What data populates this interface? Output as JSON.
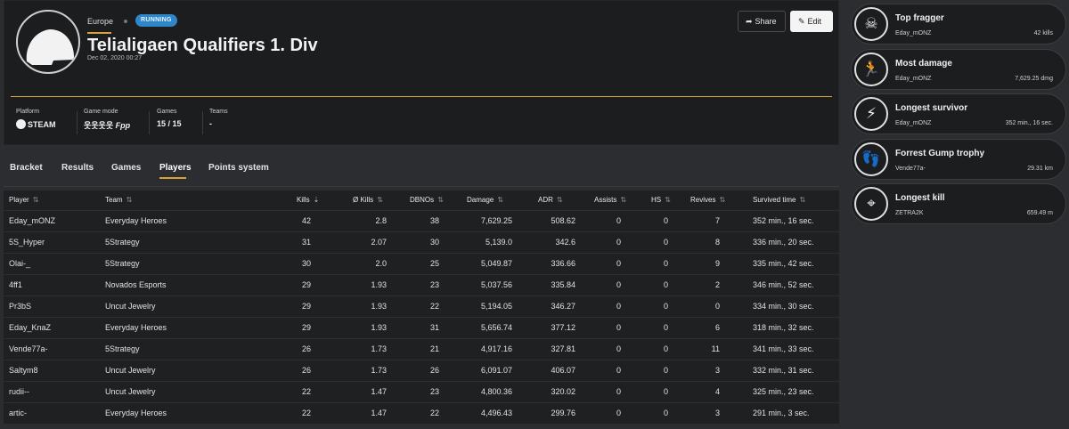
{
  "tournament": {
    "region": "Europe",
    "status": "RUNNING",
    "title": "Telialigaen Qualifiers 1. Div",
    "date": "Dec 02, 2020 00:27",
    "share_label": "Share",
    "edit_label": "Edit",
    "meta": {
      "platform_label": "Platform",
      "platform_value": "STEAM",
      "mode_label": "Game mode",
      "mode_value": "Fpp",
      "games_label": "Games",
      "games_value": "15 / 15",
      "teams_label": "Teams",
      "teams_value": "-"
    }
  },
  "tabs": [
    "Bracket",
    "Results",
    "Games",
    "Players",
    "Points system"
  ],
  "active_tab": "Players",
  "table": {
    "columns": [
      "Player",
      "Team",
      "Kills",
      "Ø Kills",
      "DBNOs",
      "Damage",
      "ADR",
      "Assists",
      "HS",
      "Revives",
      "Survived time"
    ],
    "sorted_by": "Kills",
    "rows": [
      [
        "Eday_mONZ",
        "Everyday Heroes",
        "42",
        "2.8",
        "38",
        "7,629.25",
        "508.62",
        "0",
        "0",
        "7",
        "352 min., 16 sec."
      ],
      [
        "5S_Hyper",
        "5Strategy",
        "31",
        "2.07",
        "30",
        "5,139.0",
        "342.6",
        "0",
        "0",
        "8",
        "336 min., 20 sec."
      ],
      [
        "Olai-_",
        "5Strategy",
        "30",
        "2.0",
        "25",
        "5,049.87",
        "336.66",
        "0",
        "0",
        "9",
        "335 min., 42 sec."
      ],
      [
        "4ff1",
        "Novados Esports",
        "29",
        "1.93",
        "23",
        "5,037.56",
        "335.84",
        "0",
        "0",
        "2",
        "346 min., 52 sec."
      ],
      [
        "Pr3bS",
        "Uncut Jewelry",
        "29",
        "1.93",
        "22",
        "5,194.05",
        "346.27",
        "0",
        "0",
        "0",
        "334 min., 30 sec."
      ],
      [
        "Eday_KnaZ",
        "Everyday Heroes",
        "29",
        "1.93",
        "31",
        "5,656.74",
        "377.12",
        "0",
        "0",
        "6",
        "318 min., 32 sec."
      ],
      [
        "Vende77a-",
        "5Strategy",
        "26",
        "1.73",
        "21",
        "4,917.16",
        "327.81",
        "0",
        "0",
        "11",
        "341 min., 33 sec."
      ],
      [
        "Saltym8",
        "Uncut Jewelry",
        "26",
        "1.73",
        "26",
        "6,091.07",
        "406.07",
        "0",
        "0",
        "3",
        "332 min., 31 sec."
      ],
      [
        "rudii--",
        "Uncut Jewelry",
        "22",
        "1.47",
        "23",
        "4,800.36",
        "320.02",
        "0",
        "0",
        "4",
        "325 min., 23 sec."
      ],
      [
        "artic-",
        "Everyday Heroes",
        "22",
        "1.47",
        "22",
        "4,496.43",
        "299.76",
        "0",
        "0",
        "3",
        "291 min., 3 sec."
      ]
    ]
  },
  "trophies": [
    {
      "title": "Top fragger",
      "player": "Eday_mONZ",
      "value": "42 kills",
      "icon": "skull-icon"
    },
    {
      "title": "Most damage",
      "player": "Eday_mONZ",
      "value": "7,629.25 dmg",
      "icon": "crawling-player-icon"
    },
    {
      "title": "Longest survivor",
      "player": "Eday_mONZ",
      "value": "352 min., 16 sec.",
      "icon": "zone-icon"
    },
    {
      "title": "Forrest Gump trophy",
      "player": "Vende77a-",
      "value": "29.31 km",
      "icon": "footprints-icon"
    },
    {
      "title": "Longest kill",
      "player": "ZETRA2K",
      "value": "659.49 m",
      "icon": "sniper-icon"
    }
  ],
  "colors": {
    "background": "#2b2d31",
    "card": "#1c1d1f",
    "accent": "#d8a23a",
    "status_badge": "#2f86c9"
  }
}
